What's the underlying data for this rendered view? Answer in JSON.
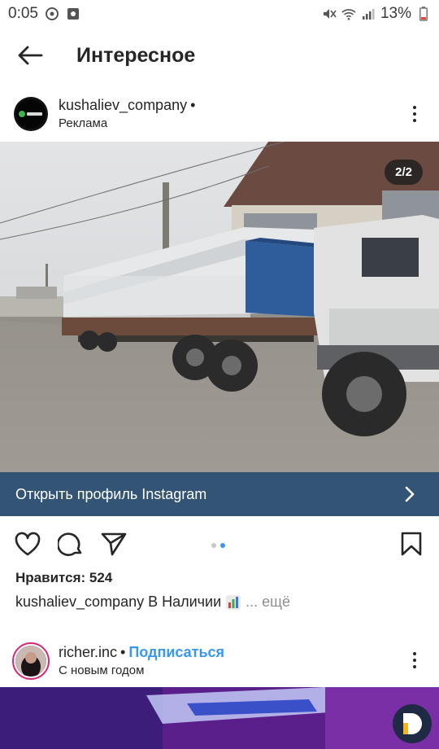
{
  "status_bar": {
    "time": "0:05",
    "battery": "13%"
  },
  "header": {
    "title": "Интересное"
  },
  "post": {
    "username": "kushaliev_company",
    "dot": "•",
    "subtitle": "Реклама",
    "counter": "2/2",
    "cta_label": "Открыть профиль Instagram",
    "likes_text": "Нравится: 524",
    "caption_user": "kushaliev_company",
    "caption_text": "В Наличии",
    "caption_more": "... ещё",
    "carousel_index": 2,
    "carousel_total": 2
  },
  "post2": {
    "username": "richer.inc",
    "dot": "•",
    "follow_label": "Подписаться",
    "subtitle": "С новым годом"
  },
  "icons": {
    "back": "arrow-left-icon",
    "more": "more-vertical-icon",
    "like": "heart-icon",
    "comment": "comment-icon",
    "share": "send-icon",
    "save": "bookmark-icon",
    "cta": "chevron-right-icon"
  },
  "colors": {
    "accent": "#3897f0",
    "cta_bg": "#335474",
    "text": "#262626",
    "muted": "#8e8e8e"
  }
}
